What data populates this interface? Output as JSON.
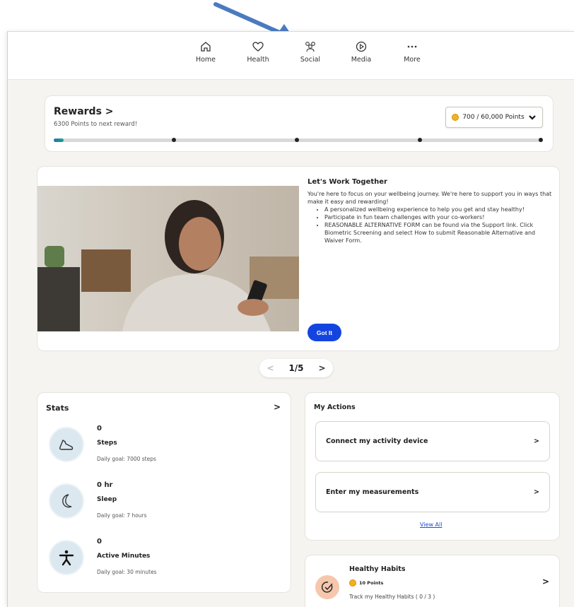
{
  "nav": {
    "items": [
      {
        "label": "Home",
        "icon": "home-icon"
      },
      {
        "label": "Health",
        "icon": "heart-icon"
      },
      {
        "label": "Social",
        "icon": "people-icon"
      },
      {
        "label": "Media",
        "icon": "play-icon"
      },
      {
        "label": "More",
        "icon": "more-dots-icon"
      }
    ]
  },
  "rewards": {
    "title": "Rewards",
    "chevron": ">",
    "subtitle": "6300 Points to next reward!",
    "points_label": "700 / 60,000 Points",
    "progress_fraction": 0.0117
  },
  "hero": {
    "title": "Let's Work Together",
    "intro": "You're here to focus on your wellbeing journey. We're here to support you in ways that make it easy and rewarding!",
    "bullets": [
      "A personalized wellbeing experience to help you get and stay healthy!",
      "Participate in fun team challenges with your co-workers!",
      "REASONABLE ALTERNATIVE FORM can be found via the Support link. Click Biometric Screening and select How to submit Reasonable Alternative and Waiver Form."
    ],
    "button": "Got It"
  },
  "pager": {
    "current": "1/5",
    "prev": "<",
    "next": ">"
  },
  "stats": {
    "title": "Stats",
    "chevron": ">",
    "items": [
      {
        "value": "0",
        "name": "Steps",
        "goal": "Daily goal: 7000 steps",
        "icon": "shoe-icon"
      },
      {
        "value": "0 hr",
        "name": "Sleep",
        "goal": "Daily goal: 7 hours",
        "icon": "moon-icon"
      },
      {
        "value": "0",
        "name": "Active Minutes",
        "goal": "Daily goal: 30 minutes",
        "icon": "person-active-icon"
      }
    ]
  },
  "actions": {
    "title": "My Actions",
    "items": [
      {
        "label": "Connect my activity device",
        "chevron": ">"
      },
      {
        "label": "Enter my measurements",
        "chevron": ">"
      }
    ],
    "view_all": "View All"
  },
  "habits": {
    "title": "Healthy Habits",
    "points": "10 Points",
    "subtitle": "Track my Healthy Habits ( 0 / 3 )",
    "chevron": ">"
  },
  "colors": {
    "accent": "#1444e0",
    "coin": "#f2b21b",
    "background": "#f6f4f0"
  }
}
